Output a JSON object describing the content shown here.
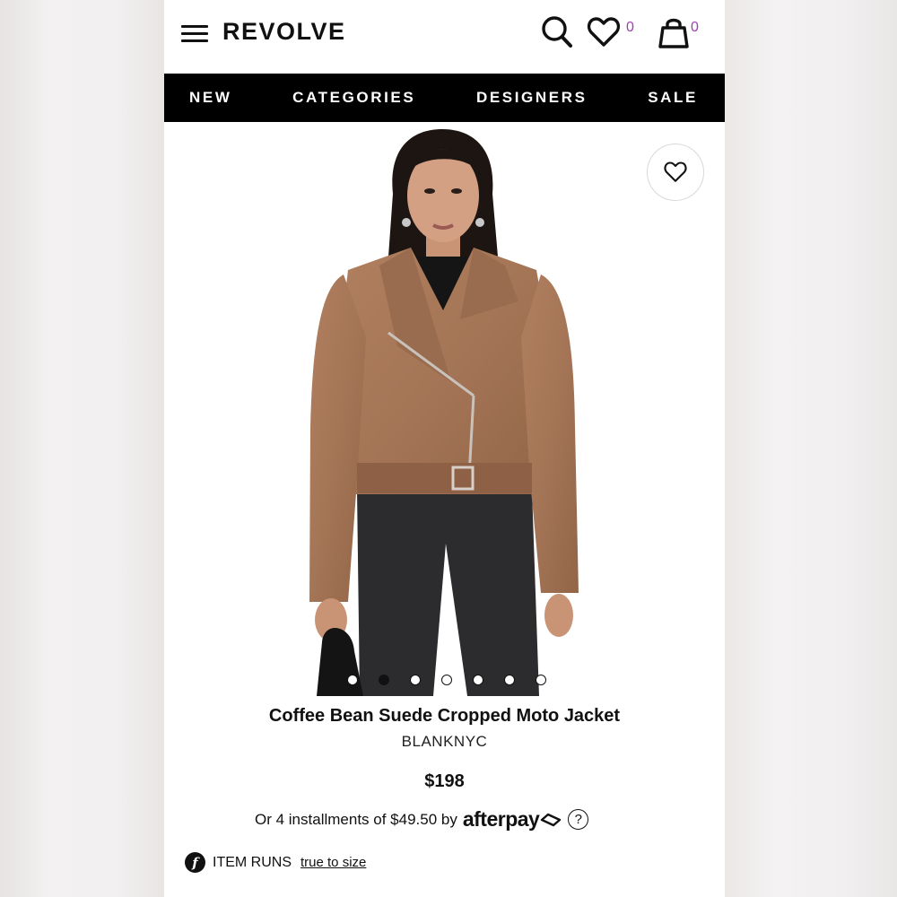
{
  "header": {
    "logo": "REVOLVE",
    "wishlist_count": "0",
    "bag_count": "0"
  },
  "nav": [
    "NEW",
    "CATEGORIES",
    "DESIGNERS",
    "SALE"
  ],
  "gallery": {
    "image_count": 7,
    "active_index": 1
  },
  "product": {
    "title": "Coffee Bean Suede Cropped Moto Jacket",
    "brand": "BLANKNYC",
    "price": "$198",
    "installments_text": "Or 4 installments of $49.50 by",
    "afterpay_label": "afterpay",
    "help_label": "?"
  },
  "fit": {
    "logo_letter": "f",
    "label": "ITEM RUNS",
    "value": "true to size"
  },
  "colors": {
    "nav_bg": "#000000",
    "count_accent": "#a040b0",
    "jacket": "#a47556"
  }
}
